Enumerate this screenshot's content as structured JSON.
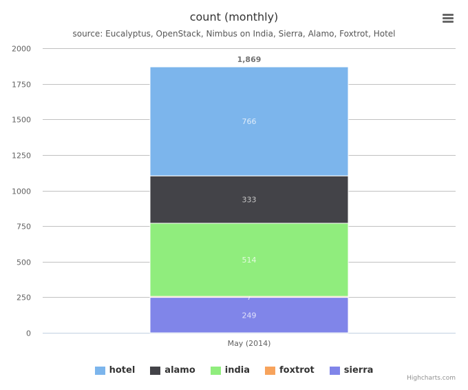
{
  "header": {
    "title": "count (monthly)",
    "subtitle": "source: Eucalyptus, OpenStack, Nimbus on India, Sierra, Alamo, Foxtrot, Hotel",
    "menu_icon": "hamburger-menu-icon"
  },
  "chart_data": {
    "type": "bar",
    "stacked": true,
    "title": "count (monthly)",
    "subtitle": "source: Eucalyptus, OpenStack, Nimbus on India, Sierra, Alamo, Foxtrot, Hotel",
    "categories": [
      "May (2014)"
    ],
    "xlabel": "",
    "ylabel": "",
    "ylim": [
      0,
      2000
    ],
    "yticks": [
      0,
      250,
      500,
      750,
      1000,
      1250,
      1500,
      1750,
      2000
    ],
    "ytick_labels": [
      "0",
      "250",
      "500",
      "750",
      "1000",
      "1250",
      "1500",
      "1750",
      "2000"
    ],
    "grid": true,
    "stack_total_labels": [
      "1,869"
    ],
    "series": [
      {
        "name": "sierra",
        "color": "#8085e9",
        "values": [
          249
        ],
        "label": "249"
      },
      {
        "name": "foxtrot",
        "color": "#f7a35c",
        "values": [
          7
        ],
        "label": "7"
      },
      {
        "name": "india",
        "color": "#90ed7d",
        "values": [
          514
        ],
        "label": "514"
      },
      {
        "name": "alamo",
        "color": "#434348",
        "values": [
          333
        ],
        "label": "333"
      },
      {
        "name": "hotel",
        "color": "#7cb5ec",
        "values": [
          766
        ],
        "label": "766"
      }
    ],
    "legend": {
      "placement": "bottom-center",
      "order": [
        "hotel",
        "alamo",
        "india",
        "foxtrot",
        "sierra"
      ]
    }
  },
  "legend_items": [
    {
      "label": "hotel",
      "color": "#7cb5ec"
    },
    {
      "label": "alamo",
      "color": "#434348"
    },
    {
      "label": "india",
      "color": "#90ed7d"
    },
    {
      "label": "foxtrot",
      "color": "#f7a35c"
    },
    {
      "label": "sierra",
      "color": "#8085e9"
    }
  ],
  "credits": "Highcharts.com"
}
